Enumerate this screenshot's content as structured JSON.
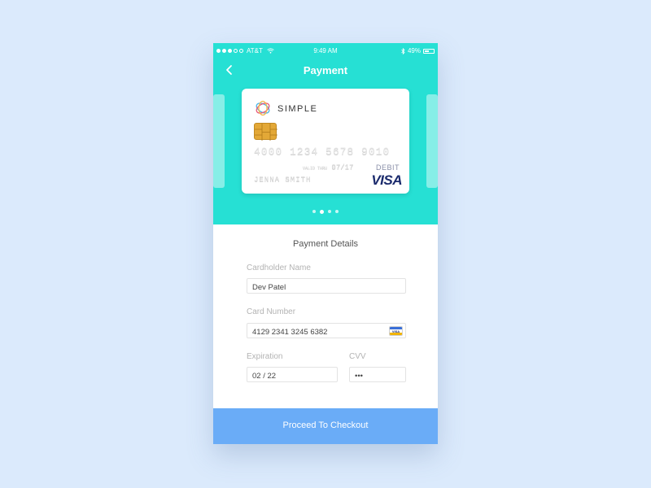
{
  "statusbar": {
    "carrier": "AT&T",
    "time": "9:49 AM",
    "battery": "49%",
    "battery_level": 0.49
  },
  "nav": {
    "title": "Payment"
  },
  "card": {
    "brand": "SIMPLE",
    "number": "4000 1234 5678 9010",
    "valid_label": "VALID THRU",
    "expiry": "07/17",
    "holder": "JENNA SMITH",
    "type": "DEBIT",
    "network": "VISA"
  },
  "pager": {
    "count": 4,
    "active_index": 1
  },
  "form": {
    "title": "Payment Details",
    "cardholder_label": "Cardholder Name",
    "cardholder_value": "Dev Patel",
    "card_number_label": "Card Number",
    "card_number_value": "4129  2341  3245  6382",
    "card_badge": "VISA",
    "expiration_label": "Expiration",
    "expiration_value": "02 / 22",
    "cvv_label": "CVV",
    "cvv_value": "•••"
  },
  "cta": {
    "label": "Proceed To Checkout"
  },
  "colors": {
    "background": "#dbeafc",
    "hero": "#26e0d4",
    "cta": "#6aacf7",
    "visa_blue": "#1a2a6c"
  },
  "icons": {
    "back": "chevron-left-icon",
    "wifi": "wifi-icon",
    "bluetooth": "bluetooth-icon",
    "battery": "battery-icon",
    "logo": "simple-logo-icon",
    "chip": "card-chip-icon",
    "card_badge": "visa-card-icon"
  }
}
